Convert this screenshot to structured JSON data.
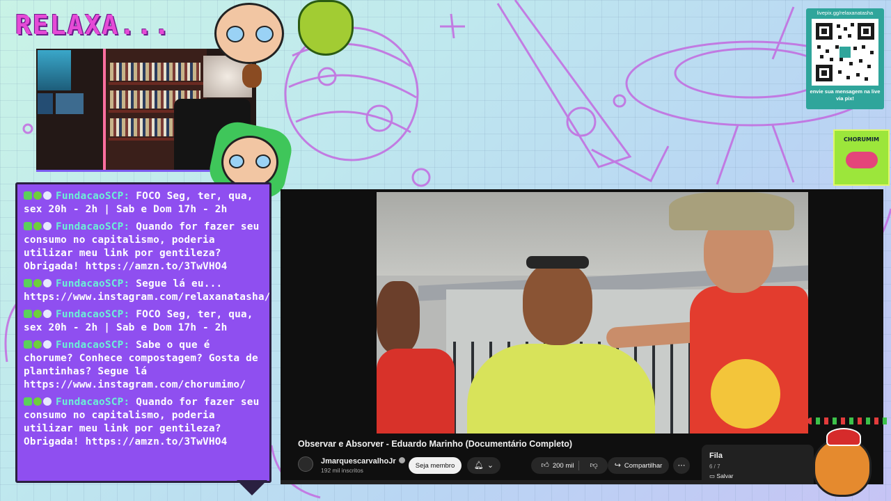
{
  "overlay": {
    "title": "RELAXA...",
    "qr": {
      "url": "livepix.gg/relaxanatasha",
      "caption": "envie sua mensagem na live via pix!"
    },
    "sponsor_badge": "CHORUMIM"
  },
  "chat": {
    "messages": [
      {
        "user": "FundacaoSCP:",
        "text": "FOCO Seg, ter, qua, sex 20h - 2h | Sab e Dom 17h - 2h"
      },
      {
        "user": "FundacaoSCP:",
        "text": "Quando for fazer seu consumo no capitalismo, poderia utilizar meu link por gentileza? Obrigada! https://amzn.to/3TwVHO4"
      },
      {
        "user": "FundacaoSCP:",
        "text": "Segue lá eu... https://www.instagram.com/relaxanatasha/"
      },
      {
        "user": "FundacaoSCP:",
        "text": "FOCO Seg, ter, qua, sex 20h - 2h | Sab e Dom 17h - 2h"
      },
      {
        "user": "FundacaoSCP:",
        "text": "Sabe o que é chorume? Conhece compostagem? Gosta de plantinhas? Segue lá https://www.instagram.com/chorumimo/"
      },
      {
        "user": "FundacaoSCP:",
        "text": "Quando for fazer seu consumo no capitalismo, poderia utilizar meu link por gentileza? Obrigada! https://amzn.to/3TwVHO4"
      }
    ]
  },
  "video": {
    "title": "Observar e Absorver - Eduardo Marinho (Documentário Completo)",
    "channel": "JmarquescarvalhoJr",
    "subscribers": "192 mil inscritos",
    "join_label": "Seja membro",
    "likes": "200 mil",
    "share_label": "Compartilhar",
    "more_icon": "more-icon",
    "colors": {
      "player_bg": "#0f0f0f",
      "pill_bg": "#272727",
      "chat_bg": "#8f4ff0",
      "username": "#6cf0d6"
    }
  },
  "queue": {
    "title": "Fila",
    "count": "6 / 7",
    "save_label": "Salvar"
  }
}
